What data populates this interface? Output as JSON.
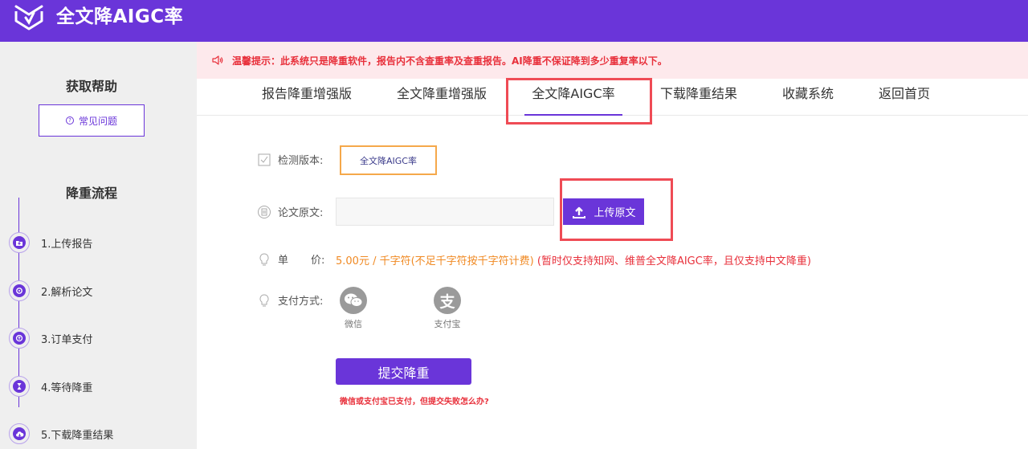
{
  "header": {
    "title": "全文降AIGC率",
    "logo_icon": "brand-logo-icon"
  },
  "sidebar": {
    "help_title": "获取帮助",
    "faq_label": "常见问题",
    "flow_title": "降重流程",
    "steps": [
      {
        "label": "1.上传报告",
        "icon": "upload-folder-icon"
      },
      {
        "label": "2.解析论文",
        "icon": "analyze-icon"
      },
      {
        "label": "3.订单支付",
        "icon": "payment-icon"
      },
      {
        "label": "4.等待降重",
        "icon": "hourglass-icon"
      },
      {
        "label": "5.下载降重结果",
        "icon": "cloud-download-icon"
      }
    ]
  },
  "notice": {
    "text": "温馨提示：此系统只是降重软件，报告内不含查重率及查重报告。AI降重不保证降到多少重复率以下。"
  },
  "tabs": [
    {
      "label": "报告降重增强版"
    },
    {
      "label": "全文降重增强版"
    },
    {
      "label": "全文降AIGC率",
      "active": true
    },
    {
      "label": "下载降重结果"
    },
    {
      "label": "收藏系统"
    },
    {
      "label": "返回首页"
    }
  ],
  "form": {
    "version_label": "检测版本:",
    "version_value": "全文降AIGC率",
    "text_label": "论文原文:",
    "text_value": "",
    "upload_label": "上传原文",
    "price_label_a": "单",
    "price_label_b": "价:",
    "price_amount": "5.00元 / 千字符(不足千字符按千字符计费)",
    "price_note": "(暂时仅支持知网、维普全文降AIGC率，且仅支持中文降重)",
    "pay_label": "支付方式:",
    "pay_options": [
      {
        "label": "微信",
        "icon": "wechat-icon"
      },
      {
        "label": "支付宝",
        "icon": "alipay-icon"
      }
    ],
    "submit_label": "提交降重",
    "fail_link": "微信或支付宝已支付，但提交失败怎么办?"
  },
  "colors": {
    "brand": "#6a35d9",
    "notice_bg": "#fde9ec",
    "warning_text": "#e8303b",
    "price_orange": "#f08a24",
    "highlight_red": "#ef4b55"
  }
}
